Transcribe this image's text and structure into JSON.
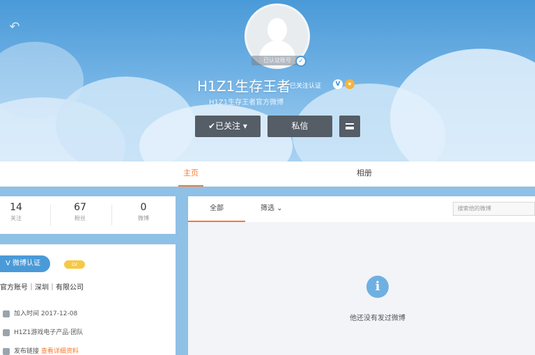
{
  "header": {
    "avatar_caption": "已认证账号",
    "name": "H1Z1生存王者",
    "badge_text": "已关注认证",
    "subtitle": "H1Z1生存王者官方微博",
    "buttons": {
      "follow": "✔已关注 ▾",
      "message": "私信"
    }
  },
  "tabs": [
    "主页",
    "相册"
  ],
  "stats": [
    {
      "value": "14",
      "label": "关注"
    },
    {
      "value": "67",
      "label": "粉丝"
    },
    {
      "value": "0",
      "label": "微博"
    }
  ],
  "info": {
    "verify_label": "V 微博认证",
    "level_tag": "LV",
    "company": "官方账号｜深圳｜有限公司",
    "rows": [
      {
        "text": "加入时间 2017-12-08",
        "highlight": ""
      },
      {
        "text": "H1Z1游戏电子产品·团队",
        "highlight": ""
      },
      {
        "text": "发布链接 ",
        "highlight": "查看详细资料"
      }
    ]
  },
  "feed": {
    "tab_all": "全部",
    "tab_filter": "筛选 ⌄",
    "search_placeholder": "搜索他的微博",
    "empty_message": "他还没有发过微博"
  },
  "colors": {
    "accent": "#f77a2c",
    "brand_blue": "#4a9ad8",
    "button_gray": "#555d66"
  }
}
